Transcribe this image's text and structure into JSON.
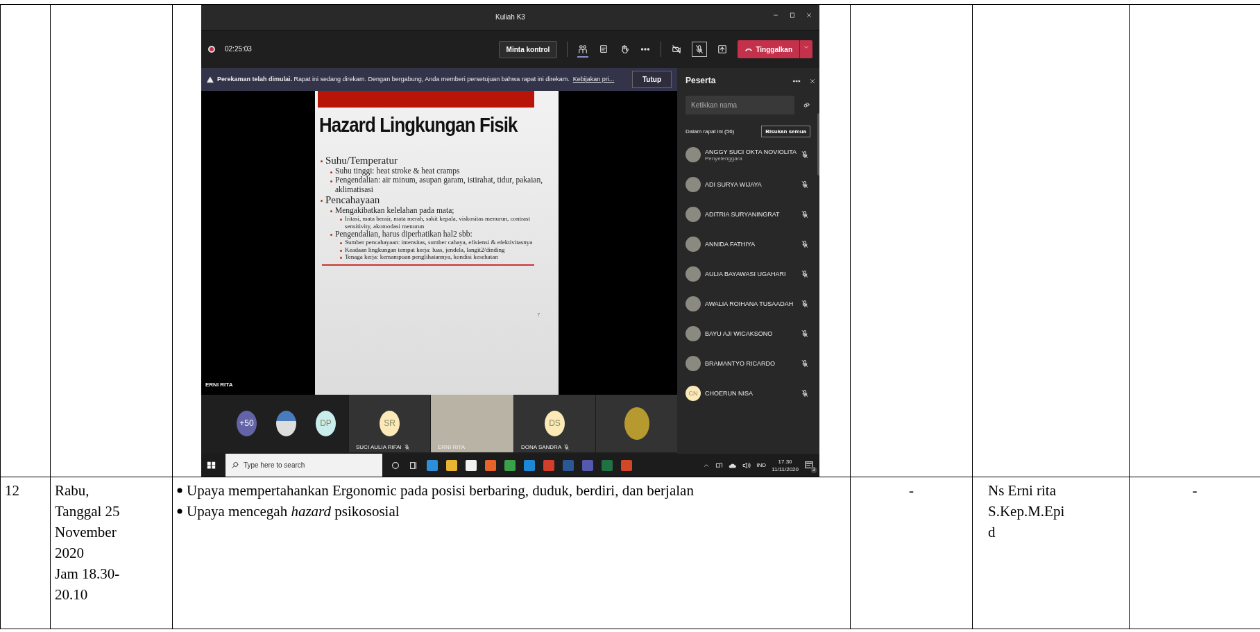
{
  "table": {
    "rows": [
      {
        "column_1": [],
        "column_2": [],
        "column_3": {
          "screenshot": {
            "window": {
              "title": "Kuliah K3"
            },
            "toolbar": {
              "timer": "02:25:03",
              "request_button": "Minta kontrol",
              "leave_button": "Tinggalkan",
              "icons": [
                {
                  "kind": "participants",
                  "selected": true
                },
                {
                  "kind": "chat",
                  "selected": false
                },
                {
                  "kind": "hand",
                  "selected": false
                },
                {
                  "kind": "more",
                  "selected": false
                },
                {
                  "kind": "camera-off",
                  "selected": false
                },
                {
                  "kind": "mic-off",
                  "selected": true
                },
                {
                  "kind": "share",
                  "selected": false
                }
              ]
            },
            "banner": {
              "text": "**Perekaman telah dimulai.**  Rapat ini sedang direkam. Dengan bergabung, Anda memberi persetujuan bahwa rapat ini direkam.",
              "link": "Kebijakan pri...",
              "button": "Tutup"
            },
            "slide": {
              "title": "Hazard Lingkungan Fisik",
              "bullets": [
                {
                  "text": "Suhu/Temperatur",
                  "children": [
                    {
                      "text": "Suhu tinggi: heat stroke & heat cramps"
                    },
                    {
                      "text": "Pengendalian: air minum, asupan garam, istirahat, tidur, pakaian, aklimatisasi"
                    }
                  ]
                },
                {
                  "text": "Pencahayaan",
                  "children": [
                    {
                      "text": "Mengakibatkan kelelahan pada mata;",
                      "children": [
                        {
                          "text": "Iritasi, mata berair, mata merah, sakit kepala, viskositas menurun, contrast sensitivity, akomodasi menurun"
                        }
                      ]
                    },
                    {
                      "text": "Pengendalian, harus diperhatikan hal2 sbb:",
                      "children": [
                        {
                          "text": "Sumber pencahayaan: intensitas, sumber cahaya, efisiensi & efektivitasnya"
                        },
                        {
                          "text": "Keadaan lingkungan tempat kerja: luas, jendela, langit2/dinding"
                        },
                        {
                          "text": "Tenaga kerja: kemampuan penglihatannya, kondisi kesehatan"
                        }
                      ]
                    }
                  ]
                }
              ],
              "page_number": "7"
            },
            "presenter": "ERNI RITA",
            "tiles": [
              {
                "kind": "group",
                "avatars": [
                  {
                    "kind": "initials",
                    "label": "+50",
                    "color": "#6264a7"
                  },
                  {
                    "kind": "photo"
                  },
                  {
                    "kind": "initials",
                    "label": "DP",
                    "color": "#c9ecec"
                  }
                ]
              },
              {
                "kind": "initials",
                "label": "SR",
                "name": "SUCI AULIA RIFAI",
                "color": "#fbe9b7"
              },
              {
                "kind": "video",
                "name": "ERNI RITA"
              },
              {
                "kind": "initials",
                "label": "DS",
                "name": "DONA SANDRA",
                "color": "#fbe9b7"
              },
              {
                "kind": "photo"
              }
            ],
            "panel": {
              "title": "Peserta",
              "search_placeholder": "Ketikkan nama",
              "section": "Dalam rapat ini (56)",
              "mute_all": "Bisukan semua",
              "participants": [
                {
                  "name": "ANGGY SUCI OKTA NOVIOLITA",
                  "role": "Penyelenggara",
                  "kind": "photo"
                },
                {
                  "name": "ADI SURYA WIJAYA",
                  "kind": "photo"
                },
                {
                  "name": "ADITRIA SURYANINGRAT",
                  "kind": "photo"
                },
                {
                  "name": "ANNIDA FATHIYA",
                  "kind": "photo"
                },
                {
                  "name": "AULIA BAYAWASI UGAHARI",
                  "kind": "photo"
                },
                {
                  "name": "AWALIA ROIHANA TUSAADAH",
                  "kind": "photo"
                },
                {
                  "name": "BAYU AJI WICAKSONO",
                  "kind": "photo"
                },
                {
                  "name": "BRAMANTYO RICARDO",
                  "kind": "photo"
                },
                {
                  "name": "CHOERUN NISA",
                  "kind": "initials",
                  "initials": "CN"
                }
              ]
            },
            "taskbar": {
              "search_placeholder": "Type here to search",
              "apps": [
                {
                  "kind": "cortana"
                },
                {
                  "kind": "task-view"
                },
                {
                  "kind": "edge"
                },
                {
                  "kind": "explorer"
                },
                {
                  "kind": "store"
                },
                {
                  "kind": "firefox"
                },
                {
                  "kind": "app"
                },
                {
                  "kind": "mail"
                },
                {
                  "kind": "chrome"
                },
                {
                  "kind": "word"
                },
                {
                  "kind": "teams"
                },
                {
                  "kind": "excel"
                },
                {
                  "kind": "powerpoint"
                }
              ],
              "language": "IND",
              "time": "17.30",
              "date": "11/11/2020",
              "notifications": "3"
            }
          }
        },
        "column_4": [],
        "column_5": [],
        "column_6": []
      },
      {
        "column_1": [
          "12"
        ],
        "column_2": [
          "Rabu,",
          "Tanggal 25",
          "November",
          "2020",
          "Jam 18.30-",
          "20.10"
        ],
        "column_3": [
          "Upaya mempertahankan Ergonomic pada posisi berbaring, duduk, berdiri, dan berjalan",
          "Upaya mencegah *hazard* psikososial"
        ],
        "column_4": [
          "-"
        ],
        "column_5": [
          "Ns Erni rita",
          "S.Kep.M.Epi",
          "d"
        ],
        "column_6": [
          "-"
        ]
      }
    ]
  }
}
